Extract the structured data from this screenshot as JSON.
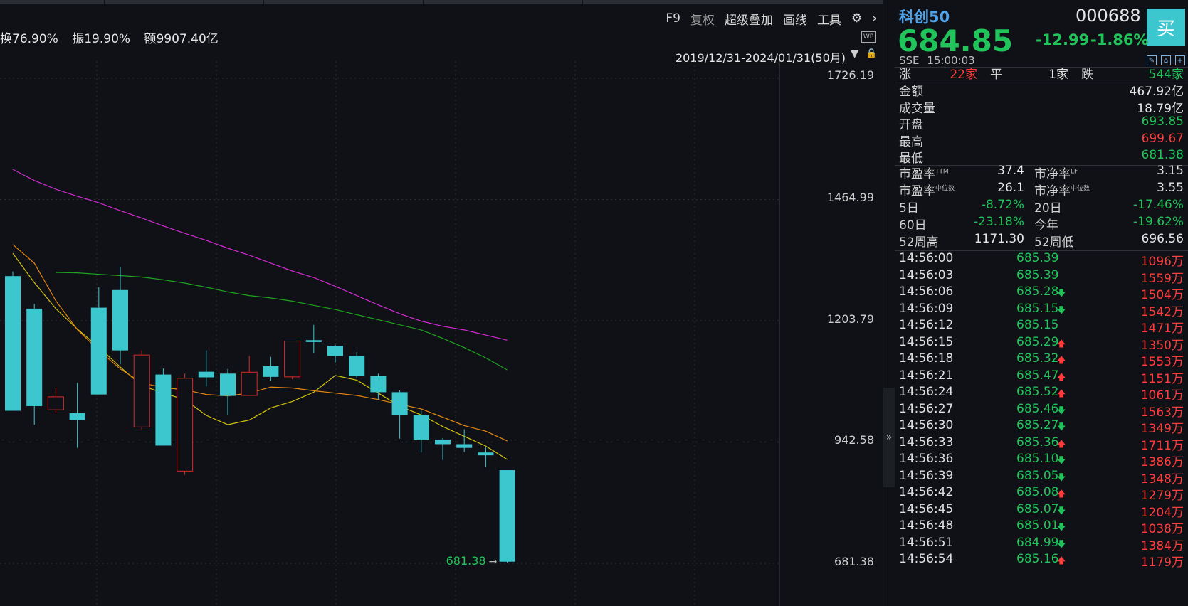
{
  "chart_header": {
    "turnover": "换76.90%",
    "amplitude": "振19.90%",
    "amount": "额9907.40亿"
  },
  "toolbar": {
    "f9": "F9",
    "fuquan": "复权",
    "overlay": "超级叠加",
    "draw": "画线",
    "tools": "工具"
  },
  "range_label": "2019/12/31-2024/01/31(50月)",
  "price_ticks": [
    "1726.19",
    "1464.99",
    "1203.79",
    "942.58",
    "681.38"
  ],
  "low_marker": "681.38",
  "chart_data": {
    "type": "candlestick",
    "ylim": [
      681.38,
      1726.19
    ],
    "candles": [
      {
        "o": 1010,
        "c": 1300,
        "h": 1310,
        "l": 1010,
        "dir": "down"
      },
      {
        "o": 1230,
        "c": 1020,
        "h": 1240,
        "l": 980,
        "dir": "down"
      },
      {
        "o": 1012,
        "c": 1040,
        "h": 1060,
        "l": 1005,
        "dir": "up"
      },
      {
        "o": 990,
        "c": 1005,
        "h": 1070,
        "l": 930,
        "dir": "down"
      },
      {
        "o": 1045,
        "c": 1232,
        "h": 1276,
        "l": 1045,
        "dir": "down"
      },
      {
        "o": 1140,
        "c": 1270,
        "h": 1320,
        "l": 1110,
        "dir": "down"
      },
      {
        "o": 975,
        "c": 1130,
        "h": 1140,
        "l": 970,
        "dir": "up"
      },
      {
        "o": 1088,
        "c": 935,
        "h": 1101,
        "l": 935,
        "dir": "down"
      },
      {
        "o": 1080,
        "c": 880,
        "h": 1090,
        "l": 872,
        "dir": "up"
      },
      {
        "o": 1094,
        "c": 1082,
        "h": 1140,
        "l": 1062,
        "dir": "down"
      },
      {
        "o": 1090,
        "c": 1042,
        "h": 1100,
        "l": 1000,
        "dir": "down"
      },
      {
        "o": 1043,
        "c": 1093,
        "h": 1128,
        "l": 1043,
        "dir": "up"
      },
      {
        "o": 1083,
        "c": 1106,
        "h": 1126,
        "l": 1075,
        "dir": "down"
      },
      {
        "o": 1083,
        "c": 1160,
        "h": 1160,
        "l": 1078,
        "dir": "up"
      },
      {
        "o": 1162,
        "c": 1158,
        "h": 1195,
        "l": 1134,
        "dir": "down"
      },
      {
        "o": 1150,
        "c": 1128,
        "h": 1152,
        "l": 1114,
        "dir": "down"
      },
      {
        "o": 1128,
        "c": 1085,
        "h": 1136,
        "l": 1080,
        "dir": "down"
      },
      {
        "o": 1085,
        "c": 1050,
        "h": 1090,
        "l": 1034,
        "dir": "down"
      },
      {
        "o": 1050,
        "c": 1000,
        "h": 1054,
        "l": 950,
        "dir": "down"
      },
      {
        "o": 1000,
        "c": 948,
        "h": 1010,
        "l": 920,
        "dir": "down"
      },
      {
        "o": 948,
        "c": 938,
        "h": 951,
        "l": 904,
        "dir": "down"
      },
      {
        "o": 938,
        "c": 930,
        "h": 970,
        "l": 921,
        "dir": "down"
      },
      {
        "o": 920,
        "c": 914,
        "h": 932,
        "l": 889,
        "dir": "down"
      },
      {
        "o": 882,
        "c": 684.85,
        "h": 882,
        "l": 681.38,
        "dir": "down"
      }
    ],
    "ma_lines": [
      {
        "color": "#d4c40e",
        "values": [
          1349,
          1286,
          1230,
          1186,
          1147,
          1104,
          1064,
          1048,
          1034,
          1000,
          980,
          990,
          1016,
          1030,
          1050,
          1086,
          1076,
          1048,
          1020,
          1001,
          976,
          955,
          934,
          905
        ]
      },
      {
        "color": "#e6870f",
        "values": [
          1368,
          1328,
          1247,
          1185,
          1140,
          1100,
          1070,
          1060,
          1055,
          1045,
          1042,
          1048,
          1061,
          1059,
          1053,
          1048,
          1043,
          1034,
          1024,
          1014,
          996,
          978,
          966,
          945
        ]
      },
      {
        "color": "#d12bd1",
        "values": [
          1530,
          1506,
          1487,
          1472,
          1458,
          1441,
          1425,
          1408,
          1392,
          1377,
          1360,
          1345,
          1328,
          1311,
          1297,
          1278,
          1258,
          1238,
          1219,
          1203,
          1192,
          1184,
          1173,
          1162
        ]
      },
      {
        "color": "#1fa31f",
        "values": [
          null,
          null,
          1308,
          1307,
          1304,
          1301,
          1298,
          1292,
          1285,
          1276,
          1266,
          1258,
          1253,
          1246,
          1237,
          1228,
          1217,
          1206,
          1195,
          1184,
          1166,
          1146,
          1124,
          1098
        ]
      }
    ],
    "colors": {
      "down_fill": "#3cc7cf",
      "up_stroke": "#d92a2a",
      "grid": "#2c2f35"
    }
  },
  "quote": {
    "name": "科创50",
    "code": "000688",
    "buy": "买",
    "price": "684.85",
    "change": "-12.99",
    "pct": "-1.86%",
    "exchange": "SSE",
    "time": "15:00:03",
    "breadth": {
      "up_label": "涨",
      "up": "22家",
      "flat_label": "平",
      "flat": "1家",
      "down_label": "跌",
      "down": "544家"
    },
    "stats": [
      {
        "label": "金额",
        "value": "467.92亿",
        "color": "white"
      },
      {
        "label": "成交量",
        "value": "18.79亿",
        "color": "white"
      },
      {
        "label": "开盘",
        "value": "693.85",
        "color": "green"
      },
      {
        "label": "最高",
        "value": "699.67",
        "color": "red"
      },
      {
        "label": "最低",
        "value": "681.38",
        "color": "green"
      }
    ],
    "valuation": {
      "pe_label": "市盈率",
      "pe_sup": "TTM",
      "pe": "37.4",
      "pb_label": "市净率",
      "pb_sup": "LF",
      "pb": "3.15",
      "pe2_label": "市盈率",
      "pe2_sup": "中位数",
      "pe2": "26.1",
      "pb2_label": "市净率",
      "pb2_sup": "中位数",
      "pb2": "3.55"
    },
    "perf": [
      {
        "l1": "5日",
        "v1": "-8.72%",
        "l2": "20日",
        "v2": "-17.46%"
      },
      {
        "l1": "60日",
        "v1": "-23.18%",
        "l2": "今年",
        "v2": "-19.62%"
      }
    ],
    "week52": {
      "high_label": "52周高",
      "high": "1171.30",
      "low_label": "52周低",
      "low": "696.56"
    },
    "trades": [
      {
        "time": "14:56:00",
        "price": "685.39",
        "dir": "",
        "vol": "1096万"
      },
      {
        "time": "14:56:03",
        "price": "685.39",
        "dir": "",
        "vol": "1559万"
      },
      {
        "time": "14:56:06",
        "price": "685.28",
        "dir": "down",
        "vol": "1504万"
      },
      {
        "time": "14:56:09",
        "price": "685.15",
        "dir": "down",
        "vol": "1542万"
      },
      {
        "time": "14:56:12",
        "price": "685.15",
        "dir": "",
        "vol": "1471万"
      },
      {
        "time": "14:56:15",
        "price": "685.29",
        "dir": "up",
        "vol": "1350万"
      },
      {
        "time": "14:56:18",
        "price": "685.32",
        "dir": "up",
        "vol": "1553万"
      },
      {
        "time": "14:56:21",
        "price": "685.47",
        "dir": "up",
        "vol": "1151万"
      },
      {
        "time": "14:56:24",
        "price": "685.52",
        "dir": "up",
        "vol": "1061万"
      },
      {
        "time": "14:56:27",
        "price": "685.46",
        "dir": "down",
        "vol": "1563万"
      },
      {
        "time": "14:56:30",
        "price": "685.27",
        "dir": "down",
        "vol": "1349万"
      },
      {
        "time": "14:56:33",
        "price": "685.36",
        "dir": "up",
        "vol": "1711万"
      },
      {
        "time": "14:56:36",
        "price": "685.10",
        "dir": "down",
        "vol": "1386万"
      },
      {
        "time": "14:56:39",
        "price": "685.05",
        "dir": "down",
        "vol": "1348万"
      },
      {
        "time": "14:56:42",
        "price": "685.08",
        "dir": "up",
        "vol": "1279万"
      },
      {
        "time": "14:56:45",
        "price": "685.07",
        "dir": "down",
        "vol": "1204万"
      },
      {
        "time": "14:56:48",
        "price": "685.01",
        "dir": "down",
        "vol": "1038万"
      },
      {
        "time": "14:56:51",
        "price": "684.99",
        "dir": "down",
        "vol": "1384万"
      },
      {
        "time": "14:56:54",
        "price": "685.16",
        "dir": "up",
        "vol": "1179万"
      }
    ]
  }
}
